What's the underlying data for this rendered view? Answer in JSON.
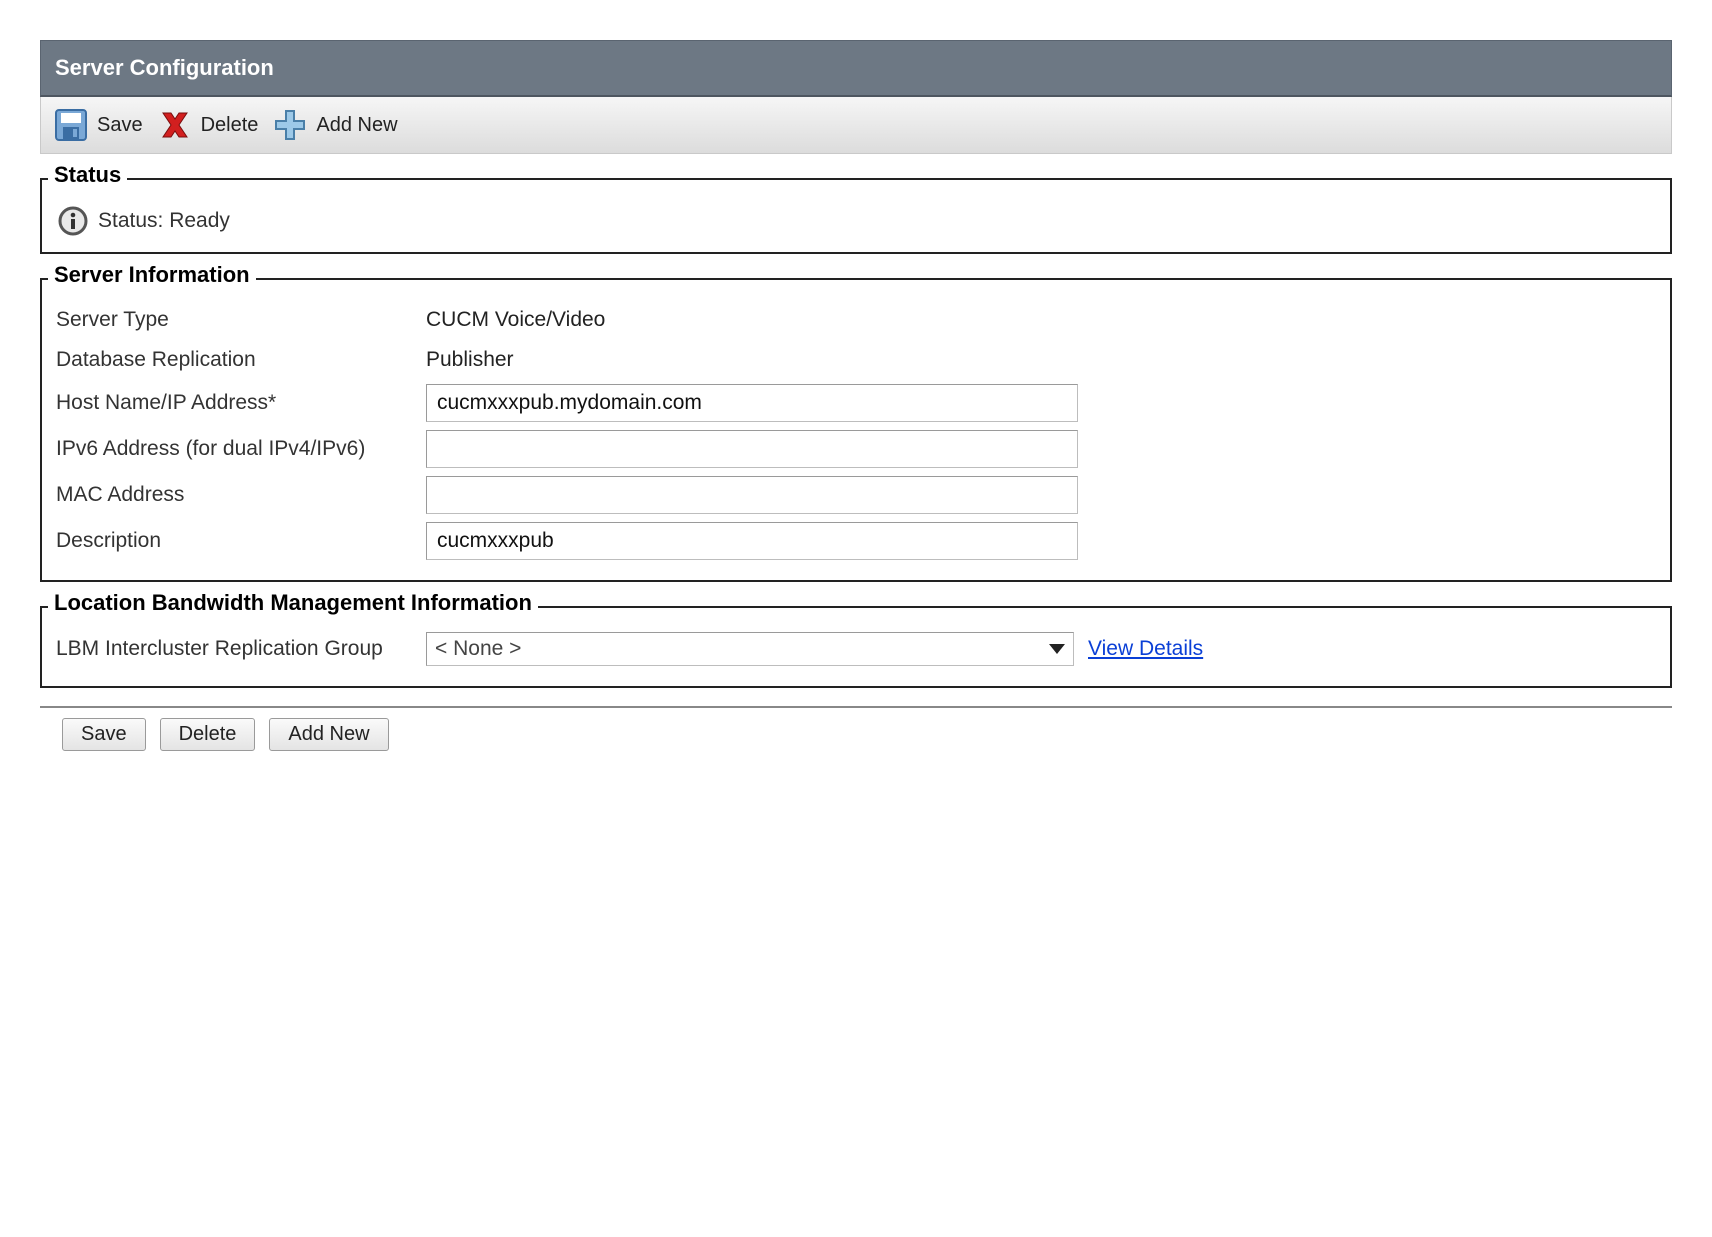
{
  "header": {
    "title": "Server Configuration"
  },
  "toolbar": {
    "save_label": "Save",
    "delete_label": "Delete",
    "addnew_label": "Add New"
  },
  "status": {
    "legend": "Status",
    "text": "Status: Ready"
  },
  "server_info": {
    "legend": "Server Information",
    "server_type_label": "Server Type",
    "server_type_value": "CUCM Voice/Video",
    "db_replication_label": "Database Replication",
    "db_replication_value": "Publisher",
    "hostname_label": "Host Name/IP Address*",
    "hostname_value": "cucmxxxpub.mydomain.com",
    "ipv6_label": "IPv6 Address (for dual IPv4/IPv6)",
    "ipv6_value": "",
    "mac_label": "MAC Address",
    "mac_value": "",
    "description_label": "Description",
    "description_value": "cucmxxxpub"
  },
  "lbm": {
    "legend": "Location Bandwidth Management Information",
    "group_label": "LBM Intercluster Replication Group",
    "selected": "< None >",
    "view_details": "View Details"
  },
  "buttons": {
    "save": "Save",
    "delete": "Delete",
    "addnew": "Add New"
  }
}
